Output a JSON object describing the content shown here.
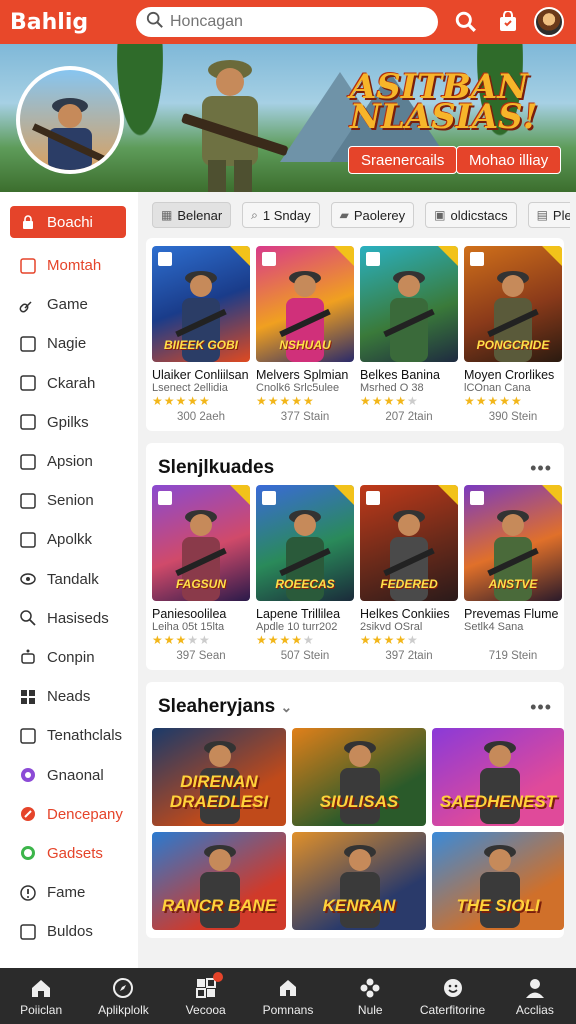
{
  "app": {
    "logo": "Bahlig"
  },
  "search": {
    "placeholder": "Honcagan"
  },
  "banner": {
    "title_line1": "ASITBAN",
    "title_line2": "NLASIAS!",
    "button1": "Sraenercails",
    "button2": "Mohao illiay"
  },
  "sidebar": {
    "items": [
      {
        "label": "Boachi",
        "icon": "lock-icon"
      },
      {
        "label": "Momtah",
        "icon": "gallery-icon"
      },
      {
        "label": "Game",
        "icon": "link-icon"
      },
      {
        "label": "Nagie",
        "icon": "tag-icon"
      },
      {
        "label": "Ckarah",
        "icon": "list-icon"
      },
      {
        "label": "Gpilks",
        "icon": "image-icon"
      },
      {
        "label": "Apsion",
        "icon": "bag-icon"
      },
      {
        "label": "Senion",
        "icon": "bookmark-icon"
      },
      {
        "label": "Apolkk",
        "icon": "window-icon"
      },
      {
        "label": "Tandalk",
        "icon": "eye-icon"
      },
      {
        "label": "Hasiseds",
        "icon": "search-icon"
      },
      {
        "label": "Conpin",
        "icon": "robot-icon"
      },
      {
        "label": "Neads",
        "icon": "grid-icon"
      },
      {
        "label": "Tenathclals",
        "icon": "frame-icon"
      },
      {
        "label": "Gnaonal",
        "icon": "chat-icon"
      },
      {
        "label": "Dencepany",
        "icon": "pin-icon"
      },
      {
        "label": "Gadsets",
        "icon": "whatsapp-icon"
      },
      {
        "label": "Fame",
        "icon": "alert-icon"
      },
      {
        "label": "Buldos",
        "icon": "calendar-icon"
      }
    ]
  },
  "filters": [
    {
      "label": "Belenar",
      "icon": "grid"
    },
    {
      "label": "1 Snday",
      "icon": "search"
    },
    {
      "label": "Paolerey",
      "icon": "car"
    },
    {
      "label": "oldicstacs",
      "icon": "window"
    },
    {
      "label": "Pley",
      "icon": "doc"
    }
  ],
  "section1": {
    "games": [
      {
        "name": "Ulaiker Conliilsan",
        "sub": "Lsenect 2ellidia",
        "stars": 5,
        "count": "300 2aeh",
        "thumb_title": "BIIEEK GOBI"
      },
      {
        "name": "Melvers Splmian",
        "sub": "Cnolk6 Srlc5ulee",
        "stars": 5,
        "count": "377 Stain",
        "thumb_title": "NSHUAU"
      },
      {
        "name": "Belkes Banina",
        "sub": "Msrhed O 38",
        "stars": 4,
        "count": "207 2tain",
        "thumb_title": ""
      },
      {
        "name": "Moyen Crorlikes",
        "sub": "lCOnan Cana",
        "stars": 5,
        "count": "390 Stein",
        "thumb_title": "PONGCRIDE"
      }
    ]
  },
  "section2": {
    "title": "Slenjlkuades",
    "games": [
      {
        "name": "Paniesoolilea",
        "sub": "Leiha 05t 15lta",
        "stars": 3,
        "count": "397 Sean",
        "thumb_title": "FAGSUN"
      },
      {
        "name": "Lapene Trillilea",
        "sub": "Apdle 10 turr202",
        "stars": 4,
        "count": "507 Stein",
        "thumb_title": "ROEECAS"
      },
      {
        "name": "Helkes Conkiies",
        "sub": "2sikvd OSral",
        "stars": 4,
        "count": "397 2tain",
        "thumb_title": "FEDERED"
      },
      {
        "name": "Prevemas Flume",
        "sub": "Setlk4 Sana",
        "stars": 0,
        "count": "719 Stein",
        "thumb_title": "ANSTVE"
      }
    ]
  },
  "section3": {
    "title": "Sleaheryjans",
    "tiles": [
      {
        "title": "DIRENAN DRAEDLESI"
      },
      {
        "title": "SIULISAS"
      },
      {
        "title": "SAEDHENEST"
      },
      {
        "title": "RANCR BANE"
      },
      {
        "title": "KENRAN"
      },
      {
        "title": "THE SIOLI"
      }
    ]
  },
  "bottom_nav": [
    {
      "label": "Poiiclan",
      "icon": "home-icon"
    },
    {
      "label": "Aplikplolk",
      "icon": "compass-icon"
    },
    {
      "label": "Vecooa",
      "icon": "apps-icon"
    },
    {
      "label": "Pomnans",
      "icon": "house-icon"
    },
    {
      "label": "Nule",
      "icon": "flower-icon"
    },
    {
      "label": "Caterfitorine",
      "icon": "smile-icon"
    },
    {
      "label": "Acclias",
      "icon": "user-icon"
    }
  ],
  "colors": {
    "accent": "#e5442a",
    "nav_bg": "#2b2b2b",
    "star": "#f2b61a"
  }
}
